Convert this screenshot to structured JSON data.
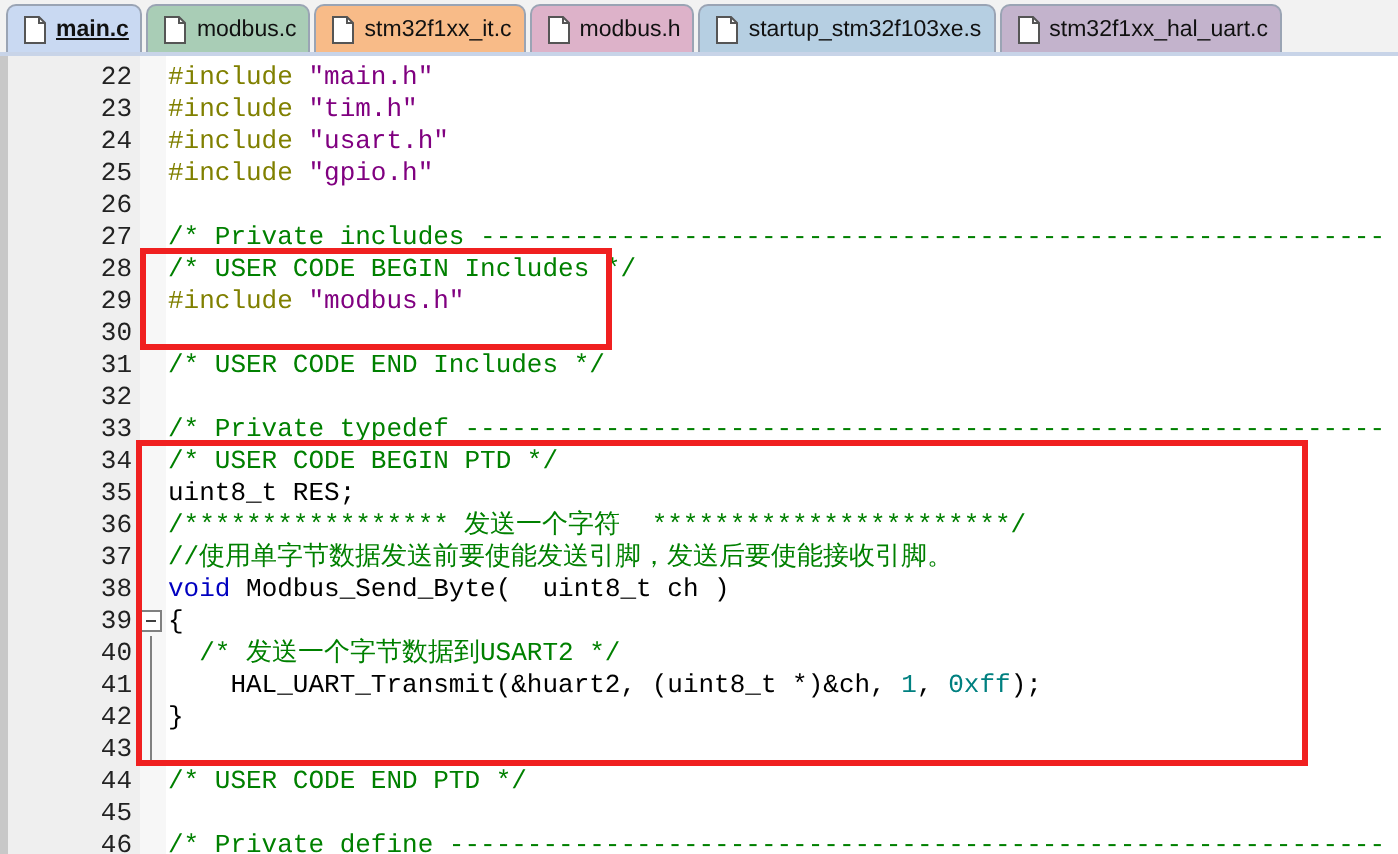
{
  "tabs": [
    {
      "label": "main.c",
      "selected": true,
      "color": "#c9d9f2"
    },
    {
      "label": "modbus.c",
      "selected": false,
      "color": "#a9cdb6"
    },
    {
      "label": "stm32f1xx_it.c",
      "selected": false,
      "color": "#f8bb88"
    },
    {
      "label": "modbus.h",
      "selected": false,
      "color": "#ddb2c9"
    },
    {
      "label": "startup_stm32f103xe.s",
      "selected": false,
      "color": "#b6cfe2"
    },
    {
      "label": "stm32f1xx_hal_uart.c",
      "selected": false,
      "color": "#c3b3cc"
    }
  ],
  "blocks": [
    {
      "kind": "plain",
      "lines": [
        {
          "number": "22",
          "tokens": [
            {
              "kind": "directive",
              "text": "#include"
            },
            {
              "kind": "string",
              "text": " \"main.h\""
            }
          ]
        },
        {
          "number": "23",
          "tokens": [
            {
              "kind": "directive",
              "text": "#include"
            },
            {
              "kind": "string",
              "text": " \"tim.h\""
            }
          ]
        },
        {
          "number": "24",
          "tokens": [
            {
              "kind": "directive",
              "text": "#include"
            },
            {
              "kind": "string",
              "text": " \"usart.h\""
            }
          ]
        },
        {
          "number": "25",
          "tokens": [
            {
              "kind": "directive",
              "text": "#include"
            },
            {
              "kind": "string",
              "text": " \"gpio.h\""
            }
          ]
        },
        {
          "number": "26"
        },
        {
          "number": "27",
          "tokens": [
            {
              "kind": "comment",
              "text": "/* Private includes ----------------------------------------------------------"
            }
          ]
        }
      ]
    },
    {
      "kind": "includes",
      "lines": [
        {
          "number": "28",
          "tokens": [
            {
              "kind": "comment",
              "text": "/* USER CODE BEGIN Includes */"
            }
          ]
        },
        {
          "number": "29",
          "tokens": [
            {
              "kind": "directive",
              "text": "#include"
            },
            {
              "kind": "string",
              "text": " \"modbus.h\""
            }
          ]
        },
        {
          "number": "30"
        }
      ]
    },
    {
      "kind": "plain",
      "lines": [
        {
          "number": "31",
          "tokens": [
            {
              "kind": "comment",
              "text": "/* USER CODE END Includes */"
            }
          ]
        },
        {
          "number": "32"
        },
        {
          "number": "33",
          "tokens": [
            {
              "kind": "comment",
              "text": "/* Private typedef -----------------------------------------------------------"
            }
          ]
        }
      ]
    },
    {
      "kind": "functions",
      "lines": [
        {
          "number": "34",
          "tokens": [
            {
              "kind": "comment",
              "text": "/* USER CODE BEGIN PTD */"
            }
          ]
        },
        {
          "number": "35",
          "tokens": [
            {
              "kind": "plain",
              "text": "uint8_t RES;"
            }
          ]
        },
        {
          "number": "36",
          "tokens": [
            {
              "kind": "comment",
              "text": "/***************** 发送一个字符  ***********************/"
            }
          ]
        },
        {
          "number": "37",
          "tokens": [
            {
              "kind": "comment",
              "text": "//使用单字节数据发送前要使能发送引脚，发送后要使能接收引脚。"
            }
          ]
        },
        {
          "number": "38",
          "tokens": [
            {
              "kind": "keyword",
              "text": "void"
            },
            {
              "kind": "plain",
              "text": " Modbus_Send_Byte(  uint8_t ch )"
            }
          ]
        },
        {
          "number": "39",
          "expanded": true,
          "tokens": [
            {
              "kind": "plain",
              "text": "{"
            }
          ],
          "children": [
            {
              "number": "40",
              "tokens": [
                {
                  "kind": "comment",
                  "text": "  /* 发送一个字节数据到USART2 */"
                }
              ]
            },
            {
              "number": "41",
              "tokens": [
                {
                  "kind": "plain",
                  "text": "    HAL_UART_Transmit(&huart2, (uint8_t *)&ch, "
                },
                {
                  "kind": "number",
                  "text": "1"
                },
                {
                  "kind": "plain",
                  "text": ", "
                },
                {
                  "kind": "number",
                  "text": "0xff"
                },
                {
                  "kind": "plain",
                  "text": ");"
                }
              ]
            },
            {
              "number": "42",
              "tokens": [
                {
                  "kind": "plain",
                  "text": "}"
                }
              ]
            },
            {
              "number": "43"
            }
          ]
        }
      ]
    },
    {
      "kind": "plain",
      "lines": [
        {
          "number": "44",
          "tokens": [
            {
              "kind": "comment",
              "text": "/* USER CODE END PTD */"
            }
          ]
        },
        {
          "number": "45"
        },
        {
          "number": "46",
          "tokens": [
            {
              "kind": "comment",
              "text": "/* Private define ------------------------------------------------------------"
            }
          ]
        }
      ]
    }
  ]
}
